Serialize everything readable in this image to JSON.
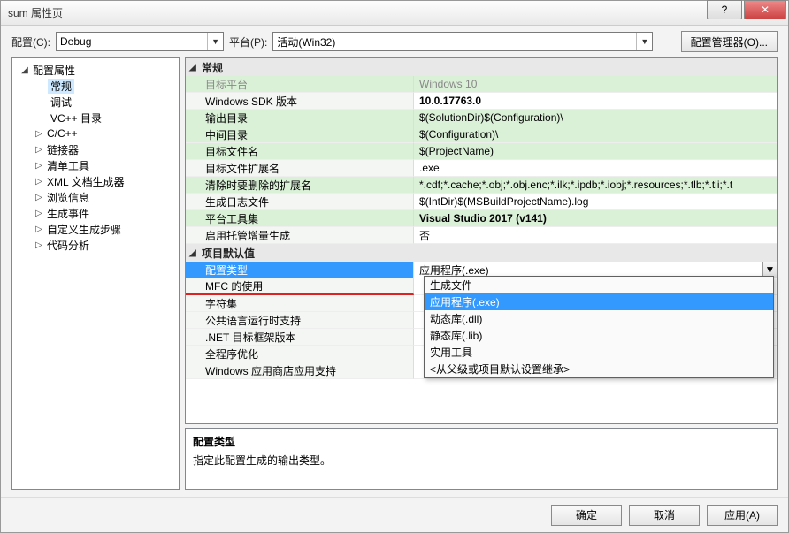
{
  "title": "sum 属性页",
  "toolbar": {
    "config_label": "配置(C):",
    "config_value": "Debug",
    "platform_label": "平台(P):",
    "platform_value": "活动(Win32)",
    "config_mgr": "配置管理器(O)..."
  },
  "tree": {
    "root": "配置属性",
    "items": [
      {
        "label": "常规",
        "leaf": true,
        "selected": true
      },
      {
        "label": "调试",
        "leaf": true
      },
      {
        "label": "VC++ 目录",
        "leaf": true
      },
      {
        "label": "C/C++",
        "leaf": false
      },
      {
        "label": "链接器",
        "leaf": false
      },
      {
        "label": "清单工具",
        "leaf": false
      },
      {
        "label": "XML 文档生成器",
        "leaf": false
      },
      {
        "label": "浏览信息",
        "leaf": false
      },
      {
        "label": "生成事件",
        "leaf": false
      },
      {
        "label": "自定义生成步骤",
        "leaf": false
      },
      {
        "label": "代码分析",
        "leaf": false
      }
    ]
  },
  "groups": [
    {
      "title": "常规",
      "rows": [
        {
          "name": "目标平台",
          "val": "Windows 10",
          "disabled": true,
          "green": true
        },
        {
          "name": "Windows SDK 版本",
          "val": "10.0.17763.0",
          "bold": true
        },
        {
          "name": "输出目录",
          "val": "$(SolutionDir)$(Configuration)\\",
          "green": true
        },
        {
          "name": "中间目录",
          "val": "$(Configuration)\\",
          "green": true
        },
        {
          "name": "目标文件名",
          "val": "$(ProjectName)",
          "green": true
        },
        {
          "name": "目标文件扩展名",
          "val": ".exe"
        },
        {
          "name": "清除时要删除的扩展名",
          "val": "*.cdf;*.cache;*.obj;*.obj.enc;*.ilk;*.ipdb;*.iobj;*.resources;*.tlb;*.tli;*.t",
          "green": true
        },
        {
          "name": "生成日志文件",
          "val": "$(IntDir)$(MSBuildProjectName).log"
        },
        {
          "name": "平台工具集",
          "val": "Visual Studio 2017 (v141)",
          "bold": true,
          "green": true
        },
        {
          "name": "启用托管增量生成",
          "val": "否"
        }
      ]
    },
    {
      "title": "项目默认值",
      "rows": [
        {
          "name": "配置类型",
          "val": "应用程序(.exe)",
          "selected": true,
          "hasDropdown": true
        },
        {
          "name": "MFC 的使用",
          "val": "",
          "redUnder": true
        },
        {
          "name": "字符集",
          "val": ""
        },
        {
          "name": "公共语言运行时支持",
          "val": ""
        },
        {
          "name": ".NET 目标框架版本",
          "val": ""
        },
        {
          "name": "全程序优化",
          "val": ""
        },
        {
          "name": "Windows 应用商店应用支持",
          "val": ""
        }
      ]
    }
  ],
  "dropdown": {
    "items": [
      "生成文件",
      "应用程序(.exe)",
      "动态库(.dll)",
      "静态库(.lib)",
      "实用工具",
      "<从父级或项目默认设置继承>"
    ],
    "selected": 1
  },
  "desc": {
    "title": "配置类型",
    "text": "指定此配置生成的输出类型。"
  },
  "footer": {
    "ok": "确定",
    "cancel": "取消",
    "apply": "应用(A)"
  }
}
